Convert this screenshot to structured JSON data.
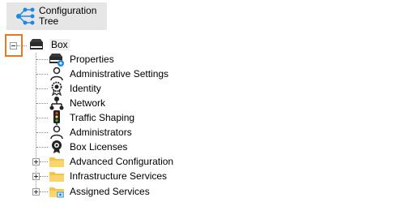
{
  "toolbar": {
    "config_tree_label": "Configuration\nTree",
    "config_tree_icon": "tree-network-icon"
  },
  "tree": {
    "root": {
      "label": "Box",
      "icon": "server-box-icon",
      "expanded": true
    },
    "children": [
      {
        "label": "Properties",
        "icon": "server-settings-icon"
      },
      {
        "label": "Administrative Settings",
        "icon": "person-outline-icon"
      },
      {
        "label": "Identity",
        "icon": "identity-badge-icon"
      },
      {
        "label": "Network",
        "icon": "network-icon"
      },
      {
        "label": "Traffic Shaping",
        "icon": "traffic-light-icon"
      },
      {
        "label": "Administrators",
        "icon": "person-outline-icon"
      },
      {
        "label": "Box Licenses",
        "icon": "license-seal-icon"
      },
      {
        "label": "Advanced Configuration",
        "icon": "folder-icon",
        "expandable": true
      },
      {
        "label": "Infrastructure Services",
        "icon": "folder-icon",
        "expandable": true
      },
      {
        "label": "Assigned Services",
        "icon": "folder-services-icon",
        "expandable": true
      }
    ]
  },
  "colors": {
    "accent_highlight": "#e87722",
    "icon_blue": "#1e88e5",
    "folder_yellow": "#f6c343"
  }
}
